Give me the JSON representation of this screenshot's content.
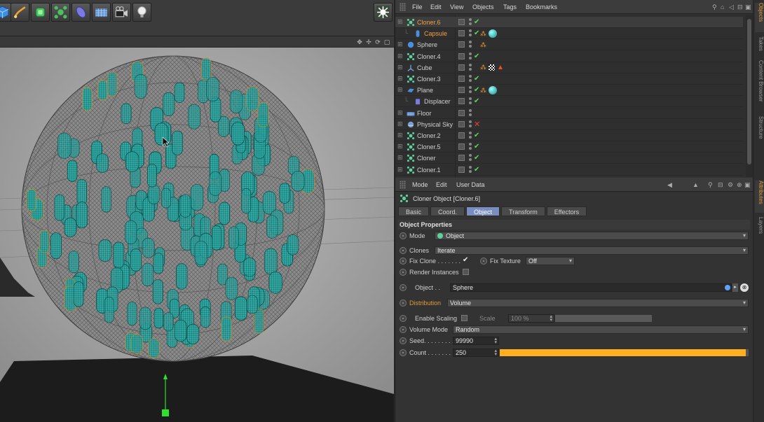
{
  "toolbar": {
    "tools": [
      {
        "icon": "cube-primitive-icon",
        "color": "#3f8fe0"
      },
      {
        "icon": "pen-spline-icon",
        "color": "#f0a030"
      },
      {
        "icon": "subdivision-surface-icon",
        "color": "#4ac060"
      },
      {
        "icon": "cloner-mograph-icon",
        "color": "#4ac060"
      },
      {
        "icon": "deformer-icon",
        "color": "#7a7adf"
      },
      {
        "icon": "floor-scene-icon",
        "color": "#7aa0d0"
      },
      {
        "icon": "camera-icon",
        "color": "#cccccc"
      },
      {
        "icon": "light-bulb-icon",
        "color": "#dddddd"
      }
    ],
    "render_icon": "mograph-render-icon"
  },
  "viewport": {
    "controls": [
      "move-view-icon",
      "zoom-view-icon",
      "rotate-view-icon",
      "maximize-view-icon"
    ]
  },
  "object_manager": {
    "menu": [
      "File",
      "Edit",
      "View",
      "Objects",
      "Tags",
      "Bookmarks"
    ],
    "objects": [
      {
        "name": "Cloner.6",
        "type": "cloner",
        "selected": true,
        "indent": 0,
        "status": "check"
      },
      {
        "name": "Capsule",
        "type": "capsule",
        "child": true,
        "indent": 1,
        "status": "check"
      },
      {
        "name": "Sphere",
        "type": "sphere",
        "indent": 0,
        "status": "none"
      },
      {
        "name": "Cloner.4",
        "type": "cloner",
        "indent": 0,
        "status": "check"
      },
      {
        "name": "Cube",
        "type": "cube",
        "indent": 0,
        "status": "none"
      },
      {
        "name": "Cloner.3",
        "type": "cloner",
        "indent": 0,
        "status": "check"
      },
      {
        "name": "Plane",
        "type": "plane",
        "indent": 0,
        "status": "check"
      },
      {
        "name": "Displacer",
        "type": "displacer",
        "indent": 1,
        "status": "check"
      },
      {
        "name": "Floor",
        "type": "floor",
        "indent": 0,
        "status": "none"
      },
      {
        "name": "Physical Sky",
        "type": "sky",
        "indent": 0,
        "status": "cross"
      },
      {
        "name": "Cloner.2",
        "type": "cloner",
        "indent": 0,
        "status": "check"
      },
      {
        "name": "Cloner.5",
        "type": "cloner",
        "indent": 0,
        "status": "check"
      },
      {
        "name": "Cloner",
        "type": "cloner",
        "indent": 0,
        "status": "check"
      },
      {
        "name": "Cloner.1",
        "type": "cloner",
        "indent": 0,
        "status": "check"
      }
    ]
  },
  "side_tabs": [
    "Objects",
    "Takes",
    "Content Browser",
    "Structure",
    "Attributes",
    "Layers"
  ],
  "attributes": {
    "menu": [
      "Mode",
      "Edit",
      "User Data"
    ],
    "title": "Cloner Object [Cloner.6]",
    "tabs": [
      "Basic",
      "Coord.",
      "Object",
      "Transform",
      "Effectors"
    ],
    "active_tab": "Object",
    "section": "Object Properties",
    "mode_label": "Mode",
    "mode_value": "Object",
    "clones_label": "Clones",
    "clones_value": "Iterate",
    "fix_clone_label": "Fix Clone . . . . . . .",
    "fix_texture_label": "Fix Texture",
    "fix_texture_value": "Off",
    "render_instances_label": "Render Instances",
    "object_label": "Object . .",
    "object_value": "Sphere",
    "distribution_label": "Distribution",
    "distribution_value": "Volume",
    "enable_scaling_label": "Enable Scaling",
    "scale_label": "Scale",
    "scale_value": "100 %",
    "volume_mode_label": "Volume Mode",
    "volume_mode_value": "Random",
    "seed_label": "Seed. . . . . . . . .",
    "seed_value": "99990",
    "count_label": "Count . . . . . . . .",
    "count_value": "250",
    "count_fill_fraction": 0.99
  }
}
